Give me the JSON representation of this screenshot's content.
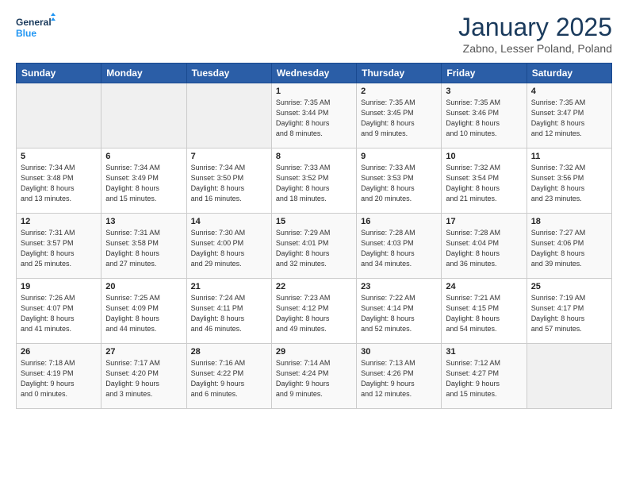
{
  "header": {
    "logo_line1": "General",
    "logo_line2": "Blue",
    "title": "January 2025",
    "subtitle": "Zabno, Lesser Poland, Poland"
  },
  "weekdays": [
    "Sunday",
    "Monday",
    "Tuesday",
    "Wednesday",
    "Thursday",
    "Friday",
    "Saturday"
  ],
  "weeks": [
    [
      {
        "num": "",
        "info": ""
      },
      {
        "num": "",
        "info": ""
      },
      {
        "num": "",
        "info": ""
      },
      {
        "num": "1",
        "info": "Sunrise: 7:35 AM\nSunset: 3:44 PM\nDaylight: 8 hours\nand 8 minutes."
      },
      {
        "num": "2",
        "info": "Sunrise: 7:35 AM\nSunset: 3:45 PM\nDaylight: 8 hours\nand 9 minutes."
      },
      {
        "num": "3",
        "info": "Sunrise: 7:35 AM\nSunset: 3:46 PM\nDaylight: 8 hours\nand 10 minutes."
      },
      {
        "num": "4",
        "info": "Sunrise: 7:35 AM\nSunset: 3:47 PM\nDaylight: 8 hours\nand 12 minutes."
      }
    ],
    [
      {
        "num": "5",
        "info": "Sunrise: 7:34 AM\nSunset: 3:48 PM\nDaylight: 8 hours\nand 13 minutes."
      },
      {
        "num": "6",
        "info": "Sunrise: 7:34 AM\nSunset: 3:49 PM\nDaylight: 8 hours\nand 15 minutes."
      },
      {
        "num": "7",
        "info": "Sunrise: 7:34 AM\nSunset: 3:50 PM\nDaylight: 8 hours\nand 16 minutes."
      },
      {
        "num": "8",
        "info": "Sunrise: 7:33 AM\nSunset: 3:52 PM\nDaylight: 8 hours\nand 18 minutes."
      },
      {
        "num": "9",
        "info": "Sunrise: 7:33 AM\nSunset: 3:53 PM\nDaylight: 8 hours\nand 20 minutes."
      },
      {
        "num": "10",
        "info": "Sunrise: 7:32 AM\nSunset: 3:54 PM\nDaylight: 8 hours\nand 21 minutes."
      },
      {
        "num": "11",
        "info": "Sunrise: 7:32 AM\nSunset: 3:56 PM\nDaylight: 8 hours\nand 23 minutes."
      }
    ],
    [
      {
        "num": "12",
        "info": "Sunrise: 7:31 AM\nSunset: 3:57 PM\nDaylight: 8 hours\nand 25 minutes."
      },
      {
        "num": "13",
        "info": "Sunrise: 7:31 AM\nSunset: 3:58 PM\nDaylight: 8 hours\nand 27 minutes."
      },
      {
        "num": "14",
        "info": "Sunrise: 7:30 AM\nSunset: 4:00 PM\nDaylight: 8 hours\nand 29 minutes."
      },
      {
        "num": "15",
        "info": "Sunrise: 7:29 AM\nSunset: 4:01 PM\nDaylight: 8 hours\nand 32 minutes."
      },
      {
        "num": "16",
        "info": "Sunrise: 7:28 AM\nSunset: 4:03 PM\nDaylight: 8 hours\nand 34 minutes."
      },
      {
        "num": "17",
        "info": "Sunrise: 7:28 AM\nSunset: 4:04 PM\nDaylight: 8 hours\nand 36 minutes."
      },
      {
        "num": "18",
        "info": "Sunrise: 7:27 AM\nSunset: 4:06 PM\nDaylight: 8 hours\nand 39 minutes."
      }
    ],
    [
      {
        "num": "19",
        "info": "Sunrise: 7:26 AM\nSunset: 4:07 PM\nDaylight: 8 hours\nand 41 minutes."
      },
      {
        "num": "20",
        "info": "Sunrise: 7:25 AM\nSunset: 4:09 PM\nDaylight: 8 hours\nand 44 minutes."
      },
      {
        "num": "21",
        "info": "Sunrise: 7:24 AM\nSunset: 4:11 PM\nDaylight: 8 hours\nand 46 minutes."
      },
      {
        "num": "22",
        "info": "Sunrise: 7:23 AM\nSunset: 4:12 PM\nDaylight: 8 hours\nand 49 minutes."
      },
      {
        "num": "23",
        "info": "Sunrise: 7:22 AM\nSunset: 4:14 PM\nDaylight: 8 hours\nand 52 minutes."
      },
      {
        "num": "24",
        "info": "Sunrise: 7:21 AM\nSunset: 4:15 PM\nDaylight: 8 hours\nand 54 minutes."
      },
      {
        "num": "25",
        "info": "Sunrise: 7:19 AM\nSunset: 4:17 PM\nDaylight: 8 hours\nand 57 minutes."
      }
    ],
    [
      {
        "num": "26",
        "info": "Sunrise: 7:18 AM\nSunset: 4:19 PM\nDaylight: 9 hours\nand 0 minutes."
      },
      {
        "num": "27",
        "info": "Sunrise: 7:17 AM\nSunset: 4:20 PM\nDaylight: 9 hours\nand 3 minutes."
      },
      {
        "num": "28",
        "info": "Sunrise: 7:16 AM\nSunset: 4:22 PM\nDaylight: 9 hours\nand 6 minutes."
      },
      {
        "num": "29",
        "info": "Sunrise: 7:14 AM\nSunset: 4:24 PM\nDaylight: 9 hours\nand 9 minutes."
      },
      {
        "num": "30",
        "info": "Sunrise: 7:13 AM\nSunset: 4:26 PM\nDaylight: 9 hours\nand 12 minutes."
      },
      {
        "num": "31",
        "info": "Sunrise: 7:12 AM\nSunset: 4:27 PM\nDaylight: 9 hours\nand 15 minutes."
      },
      {
        "num": "",
        "info": ""
      }
    ]
  ]
}
